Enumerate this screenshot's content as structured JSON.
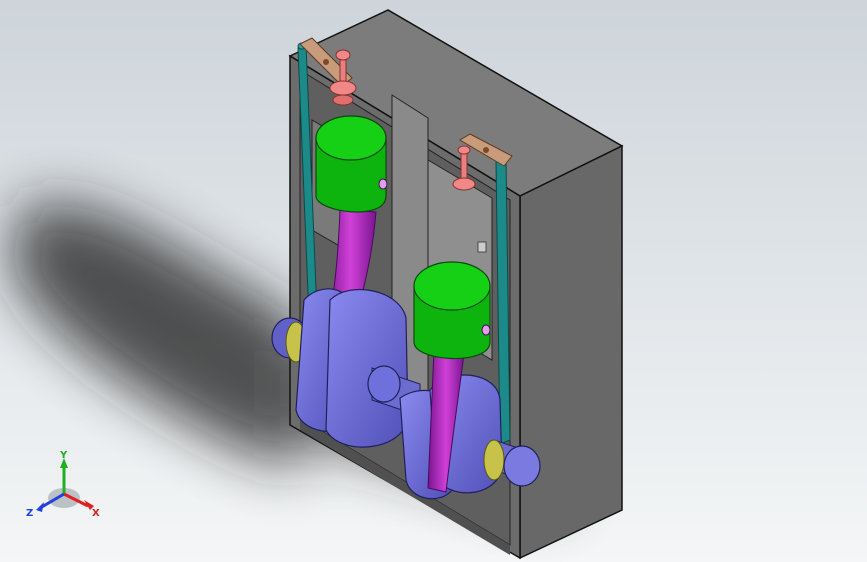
{
  "viewport": {
    "background_top": "#cdd4da",
    "background_bottom": "#f4f6f7"
  },
  "model": {
    "components": [
      "engine-block",
      "piston-left",
      "piston-right",
      "connecting-rod-left",
      "connecting-rod-right",
      "crankshaft",
      "pushrod-left",
      "pushrod-right",
      "rocker-arm-left",
      "rocker-arm-right",
      "valve-left",
      "valve-right"
    ],
    "colors": {
      "block": "#6f6f6f",
      "piston": "#0dbb0d",
      "connecting_rod": "#b01cc0",
      "crankshaft": "#6e6ed8",
      "pushrod": "#1d8a8a",
      "rocker": "#c89b7a",
      "valve": "#e88080",
      "bushing": "#c6c24a"
    }
  },
  "triad": {
    "x_label": "X",
    "y_label": "Y",
    "z_label": "Z",
    "x_color": "#e02020",
    "y_color": "#20b020",
    "z_color": "#2040e0"
  }
}
